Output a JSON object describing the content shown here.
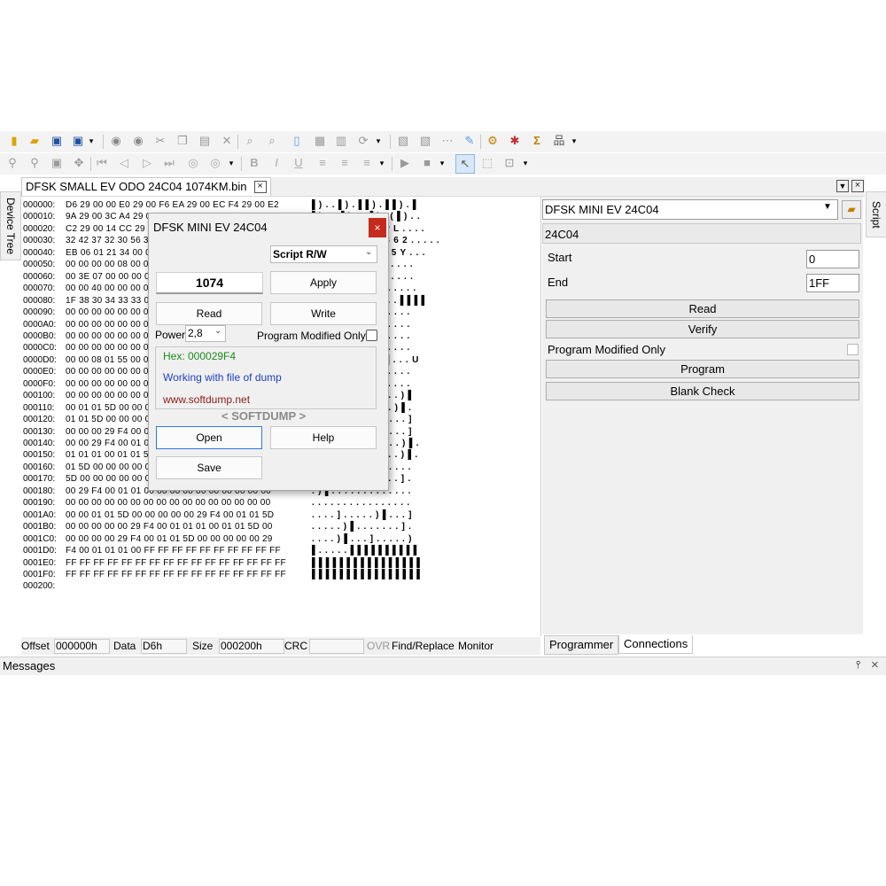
{
  "toolbar1": {
    "icons": [
      "new-file-icon",
      "open-folder-icon",
      "save-icon",
      "save-as-icon",
      "dropdown-arrow",
      "undo-icon",
      "redo-icon",
      "cut-icon",
      "copy-icon",
      "paste-icon",
      "delete-icon",
      "find-icon",
      "find-replace-icon",
      "document-icon",
      "fill-icon",
      "compare-icon",
      "reload-icon",
      "dropdown-arrow",
      "page-prev-icon",
      "page-next-icon",
      "grid-icon",
      "edit-icon",
      "settings-icon",
      "bug-icon",
      "checksum-icon",
      "tree-icon",
      "dropdown-arrow"
    ]
  },
  "toolbar2": {
    "icons": [
      "zoom-in-icon",
      "zoom-out-icon",
      "fit-icon",
      "move-icon",
      "first-icon",
      "prev-icon",
      "next-icon",
      "last-icon",
      "back-icon",
      "forward-icon",
      "dropdown-arrow",
      "bold-icon",
      "italic-icon",
      "underline-icon",
      "align-left-icon",
      "align-center-icon",
      "align-right-icon",
      "dropdown-arrow",
      "play-icon",
      "stop-icon",
      "dropdown-arrow",
      "select-icon",
      "zoom-select-icon",
      "capture-icon",
      "dropdown-arrow"
    ]
  },
  "file_tab": {
    "label": "DFSK SMALL EV ODO 24C04 1074KM.bin"
  },
  "side_tabs": {
    "left": "Device Tree",
    "right": "Script"
  },
  "hex": {
    "rows": [
      {
        "offset": "000000:",
        "bytes": "D6 29 00 00 E0 29 00 F6 EA 29 00 EC F4 29 00 E2",
        "ascii": "▌) . . ▌) . ▌▌) . ▌▌) . ▌"
      },
      {
        "offset": "000010:",
        "bytes": "9A 29 00 3C A4 29 00 32 AE 29 00 28 B8 29 00 1E",
        "ascii": "▌) . < ▌) . 2 ▌) . ( ▌) . ."
      },
      {
        "offset": "000020:",
        "bytes": "C2 29 00 14 CC 29 00 0A 4C 56 50 4C 00 00 00 00",
        "ascii": "▌) . . ▌) . . L V P L . . . ."
      },
      {
        "offset": "000030:",
        "bytes": "32 42 37 32 30 56 31 35 33 36 32 00 00 00 00 00",
        "ascii": "2 B 7 2 0 V 1 5 3 6 2 . . . . ."
      },
      {
        "offset": "000040:",
        "bytes": "EB 06 01 21 34 00 00 00 40 00 00 35 59 00 00 00",
        "ascii": "▌. . ! 4 . . . @ . . 5 Y . . ."
      },
      {
        "offset": "000050:",
        "bytes": "00 00 00 00 08 00 00 00 00 00 00 00 00 00 00 00",
        "ascii": ". . . . . . . . ▌0 . . . . . ."
      },
      {
        "offset": "000060:",
        "bytes": "00 3E 07 00 00 00 00 00 00 00 00 00 00 00 00 00",
        "ascii": ". > . . . . . . . . ▌. . . . ."
      },
      {
        "offset": "000070:",
        "bytes": "00 00 40 00 00 00 00 00 00 00 00 00 00 00 00 00",
        "ascii": ". . @ . . . . . . . . . . . . ."
      },
      {
        "offset": "000080:",
        "bytes": "1F 38 30 34 33 33 00 00 00 00 00 00 FF FF FF FF",
        "ascii": ". 8 0 4 3 3 . . . . . . ▌▌▌▌"
      },
      {
        "offset": "000090:",
        "bytes": "00 00 00 00 00 00 00 00 00 00 00 00 00 00 00 00",
        "ascii": ". . . . . . . . . . . . . . . ."
      },
      {
        "offset": "0000A0:",
        "bytes": "00 00 00 00 00 00 00 00 00 00 00 00 00 00 00 00",
        "ascii": ". . . . . . . . . . . . . . . ."
      },
      {
        "offset": "0000B0:",
        "bytes": "00 00 00 00 00 00 00 00 00 00 00 00 00 00 00 00",
        "ascii": ". . . . . . . . . . . . . . . ."
      },
      {
        "offset": "0000C0:",
        "bytes": "00 00 00 00 00 00 00 00 00 00 00 00 00 00 00 00",
        "ascii": ". . . . . . . . . . . . . . . ."
      },
      {
        "offset": "0000D0:",
        "bytes": "00 00 08 01 55 00 00 00 00 00 29 FF 00 00 00 55",
        "ascii": ". . . . U . . . . . ) ▌. . . U"
      },
      {
        "offset": "0000E0:",
        "bytes": "00 00 00 00 00 00 00 00 00 00 00 00 00 00 00 00",
        "ascii": ". . . . . . . . . . . . . . . ."
      },
      {
        "offset": "0000F0:",
        "bytes": "00 00 00 00 00 00 00 00 00 00 00 00 00 00 00 00",
        "ascii": ". . . . . . . . . . . . . . . ."
      },
      {
        "offset": "000100:",
        "bytes": "00 00 00 00 00 00 00 00 5D 00 00 00 00 00 29 F4",
        "ascii": ". . . . . . . . ] . . . . . ) ▌"
      },
      {
        "offset": "000110:",
        "bytes": "00 01 01 5D 00 00 00 00 00 00 00 00 00 29 F4 00",
        "ascii": ". . . ] . . . . . . . . . ) ▌."
      },
      {
        "offset": "000120:",
        "bytes": "01 01 5D 00 00 00 00 00 00 00 29 F4 00 01 01 5D",
        "ascii": ". . ] . . . . . . . ) ▌. . . ]"
      },
      {
        "offset": "000130:",
        "bytes": "00 00 00 29 F4 00 01 01 5D 00 00 00 00 00 00 5D",
        "ascii": ". . . ) ▌. . . ] . . . . . . ]"
      },
      {
        "offset": "000140:",
        "bytes": "00 00 29 F4 00 01 01 5D 00 00 00 00 00 00 29 F4",
        "ascii": ". . ) ▌. . . ] . . . . . . ) ▌."
      },
      {
        "offset": "000150:",
        "bytes": "01 01 01 00 01 01 5D 00 00 00 00 00 00 00 29 00",
        "ascii": ". . . . . . ] . . . . . . . ) ▌."
      },
      {
        "offset": "000160:",
        "bytes": "01 5D 00 00 00 00 00 00 FF 00 00 00 00 00 00 00",
        "ascii": ". ] . . . . . . ▌. . . . . . ."
      },
      {
        "offset": "000170:",
        "bytes": "5D 00 00 00 00 00 00 00 00 00 00 00 00 00 5D 00",
        "ascii": "] . . . . . . . . . . . . . ] ."
      },
      {
        "offset": "000180:",
        "bytes": "00 29 F4 00 01 01 00 00 00 00 00 00 00 00 00 00",
        "ascii": ". ) ▌. . . . . . . . . . . . ."
      },
      {
        "offset": "000190:",
        "bytes": "00 00 00 00 00 00 00 00 00 00 00 00 00 00 00 00",
        "ascii": ". . . . . . . . . . . . . . . ."
      },
      {
        "offset": "0001A0:",
        "bytes": "00 00 01 01 5D 00 00 00 00 00 29 F4 00 01 01 5D",
        "ascii": ". . . . ] . . . . . ) ▌. . . ]"
      },
      {
        "offset": "0001B0:",
        "bytes": "00 00 00 00 00 29 F4 00 01 01 01 00 01 01 5D 00",
        "ascii": ". . . . . ) ▌. . . . . . . ] ."
      },
      {
        "offset": "0001C0:",
        "bytes": "00 00 00 00 29 F4 00 01 01 5D 00 00 00 00 00 29",
        "ascii": ". . . . ) ▌. . . ] . . . . . )"
      },
      {
        "offset": "0001D0:",
        "bytes": "F4 00 01 01 01 00 FF FF FF FF FF FF FF FF FF FF",
        "ascii": "▌. . . . . ▌▌▌▌▌▌▌▌▌▌"
      },
      {
        "offset": "0001E0:",
        "bytes": "FF FF FF FF FF FF FF FF FF FF FF FF FF FF FF FF",
        "ascii": "▌▌▌▌▌▌▌▌▌▌▌▌▌▌▌▌"
      },
      {
        "offset": "0001F0:",
        "bytes": "FF FF FF FF FF FF FF FF FF FF FF FF FF FF FF FF",
        "ascii": "▌▌▌▌▌▌▌▌▌▌▌▌▌▌▌▌"
      },
      {
        "offset": "000200:",
        "bytes": "",
        "ascii": ""
      }
    ]
  },
  "status": {
    "offset_label": "Offset",
    "offset_value": "000000h",
    "data_label": "Data",
    "data_value": "D6h",
    "size_label": "Size",
    "size_value": "000200h",
    "crc_label": "CRC",
    "crc_value": "",
    "ovr": "OVR",
    "find_replace": "Find/Replace",
    "monitor": "Monitor"
  },
  "right_panel": {
    "device_select": "DFSK MINI EV 24C04",
    "chip": "24C04",
    "start_label": "Start",
    "start_value": "0",
    "end_label": "End",
    "end_value": "1FF",
    "read": "Read",
    "verify": "Verify",
    "program_modified_only": "Program Modified Only",
    "program": "Program",
    "blank_check": "Blank Check"
  },
  "bottom_tabs": [
    "Programmer",
    "Connections"
  ],
  "messages": {
    "title": "Messages",
    "pin": "ꟷ",
    "close": "×"
  },
  "dialog": {
    "title": "DFSK MINI EV 24C04",
    "close": "×",
    "script_select": "Script R/W",
    "value": "1074",
    "apply": "Apply",
    "read": "Read",
    "write": "Write",
    "power_label": "Power",
    "power_value": "2,8",
    "program_modified_only": "Program Modified Only",
    "hex_text": "Hex: 000029F4",
    "status_text": "Working with file of dump",
    "url_text": "www.softdump.net",
    "brand": "< SOFTDUMP >",
    "open": "Open",
    "help": "Help",
    "save": "Save",
    "colors": {
      "hex": "#1a8a1a",
      "status": "#1f3fbf",
      "url": "#8a1a1a",
      "brand": "#8a8a8a",
      "close_bg": "#c42b1c"
    }
  }
}
